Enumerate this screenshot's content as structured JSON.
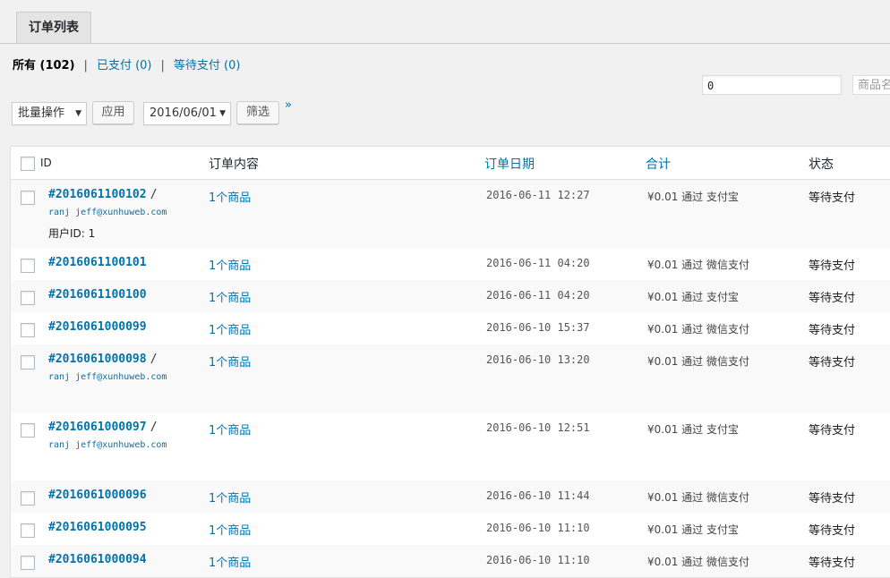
{
  "tab": {
    "label": "订单列表"
  },
  "filters": {
    "all": "所有 (102)",
    "paid": "已支付 (0)",
    "pending": "等待支付 (0)"
  },
  "search": {
    "value": "0",
    "placeholder2": "商品名"
  },
  "actions": {
    "bulk_label": "批量操作",
    "apply_label": "应用",
    "date_value": "2016/06/01",
    "filter_label": "筛选",
    "next_page": "»"
  },
  "columns": {
    "id": "ID",
    "content": "订单内容",
    "date": "订单日期",
    "total": "合计",
    "status": "状态"
  },
  "rows": [
    {
      "id": "#2016061100102",
      "customer": "ranj jeff@xunhuweb.com",
      "uid": "用户ID: 1",
      "items": "1个商品",
      "date": "2016-06-11 12:27",
      "total": "¥0.01 通过 支付宝",
      "status": "等待支付"
    },
    {
      "id": "#2016061100101",
      "customer": "",
      "uid": "",
      "items": "1个商品",
      "date": "2016-06-11 04:20",
      "total": "¥0.01 通过 微信支付",
      "status": "等待支付"
    },
    {
      "id": "#2016061100100",
      "customer": "",
      "uid": "",
      "items": "1个商品",
      "date": "2016-06-11 04:20",
      "total": "¥0.01 通过 支付宝",
      "status": "等待支付"
    },
    {
      "id": "#2016061000099",
      "customer": "",
      "uid": "",
      "items": "1个商品",
      "date": "2016-06-10 15:37",
      "total": "¥0.01 通过 微信支付",
      "status": "等待支付"
    },
    {
      "id": "#2016061000098",
      "customer": "ranj jeff@xunhuweb.com",
      "uid": "",
      "items": "1个商品",
      "date": "2016-06-10 13:20",
      "total": "¥0.01 通过 微信支付",
      "status": "等待支付"
    },
    {
      "id": "#2016061000097",
      "customer": "ranj jeff@xunhuweb.com",
      "uid": "",
      "items": "1个商品",
      "date": "2016-06-10 12:51",
      "total": "¥0.01 通过 支付宝",
      "status": "等待支付"
    },
    {
      "id": "#2016061000096",
      "customer": "",
      "uid": "",
      "items": "1个商品",
      "date": "2016-06-10 11:44",
      "total": "¥0.01 通过 微信支付",
      "status": "等待支付"
    },
    {
      "id": "#2016061000095",
      "customer": "",
      "uid": "",
      "items": "1个商品",
      "date": "2016-06-10 11:10",
      "total": "¥0.01 通过 支付宝",
      "status": "等待支付"
    },
    {
      "id": "#2016061000094",
      "customer": "",
      "uid": "",
      "items": "1个商品",
      "date": "2016-06-10 11:10",
      "total": "¥0.01 通过 微信支付",
      "status": "等待支付"
    }
  ]
}
